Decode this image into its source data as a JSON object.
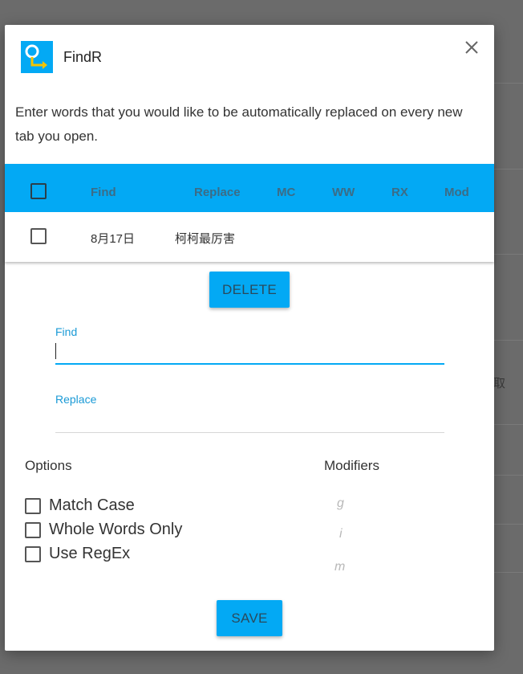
{
  "app": {
    "title": "FindR",
    "close_label": "×",
    "intro_text": "Enter words that you would like to be automatically replaced on every new tab you open."
  },
  "table": {
    "columns": [
      "Find",
      "Replace",
      "MC",
      "WW",
      "RX",
      "Mod"
    ],
    "rows": [
      {
        "find": "8月17日",
        "replace": "柯柯最厉害",
        "mc": "",
        "ww": "",
        "rx": "",
        "mod": ""
      }
    ]
  },
  "actions": {
    "delete_label": "DELETE",
    "save_label": "SAVE"
  },
  "form": {
    "find_label": "Find",
    "find_value": "",
    "replace_label": "Replace",
    "replace_value": ""
  },
  "options": {
    "title": "Options",
    "items": [
      "Match Case",
      "Whole Words Only",
      "Use RegEx"
    ]
  },
  "modifiers": {
    "title": "Modifiers",
    "items": [
      "g",
      "i",
      "m"
    ]
  },
  "background": {
    "glyphs": [
      "取"
    ]
  },
  "colors": {
    "accent": "#03a9f4",
    "overlay": "#6b6b6b",
    "label": "#1a9ad6"
  }
}
